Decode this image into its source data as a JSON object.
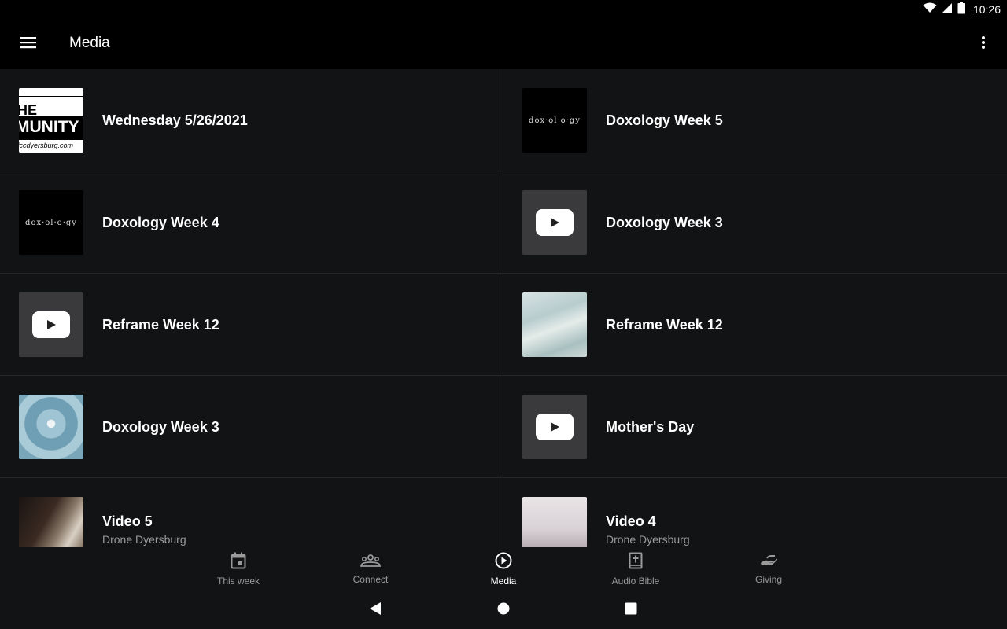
{
  "status_bar": {
    "time": "10:26"
  },
  "app_bar": {
    "title": "Media"
  },
  "media_items": [
    {
      "title": "Wednesday 5/26/2021",
      "subtitle": "",
      "thumb": "community",
      "thumb_text": [
        "HE",
        "MUNITY",
        "fccdyersburg.com"
      ]
    },
    {
      "title": "Doxology Week 5",
      "subtitle": "",
      "thumb": "doxology",
      "thumb_text": [
        "dox·ol·o·gy"
      ]
    },
    {
      "title": "Doxology Week 4",
      "subtitle": "",
      "thumb": "doxology",
      "thumb_text": [
        "dox·ol·o·gy"
      ]
    },
    {
      "title": "Doxology Week 3",
      "subtitle": "",
      "thumb": "youtube"
    },
    {
      "title": "Reframe Week 12",
      "subtitle": "",
      "thumb": "youtube"
    },
    {
      "title": "Reframe Week 12",
      "subtitle": "",
      "thumb": "water"
    },
    {
      "title": "Doxology Week 3",
      "subtitle": "",
      "thumb": "succulent"
    },
    {
      "title": "Mother's Day",
      "subtitle": "",
      "thumb": "youtube"
    },
    {
      "title": "Video 5",
      "subtitle": "Drone Dyersburg",
      "thumb": "desk"
    },
    {
      "title": "Video 4",
      "subtitle": "Drone Dyersburg",
      "thumb": "sky"
    }
  ],
  "bottom_nav": [
    {
      "label": "This week",
      "icon": "calendar-icon",
      "active": false
    },
    {
      "label": "Connect",
      "icon": "people-icon",
      "active": false
    },
    {
      "label": "Media",
      "icon": "play-circle-icon",
      "active": true
    },
    {
      "label": "Audio Bible",
      "icon": "bible-icon",
      "active": false
    },
    {
      "label": "Giving",
      "icon": "giving-hand-icon",
      "active": false
    }
  ],
  "colors": {
    "background": "#121315",
    "divider": "#26272a",
    "bar": "#000000",
    "secondary_text": "#9a9a9a"
  }
}
